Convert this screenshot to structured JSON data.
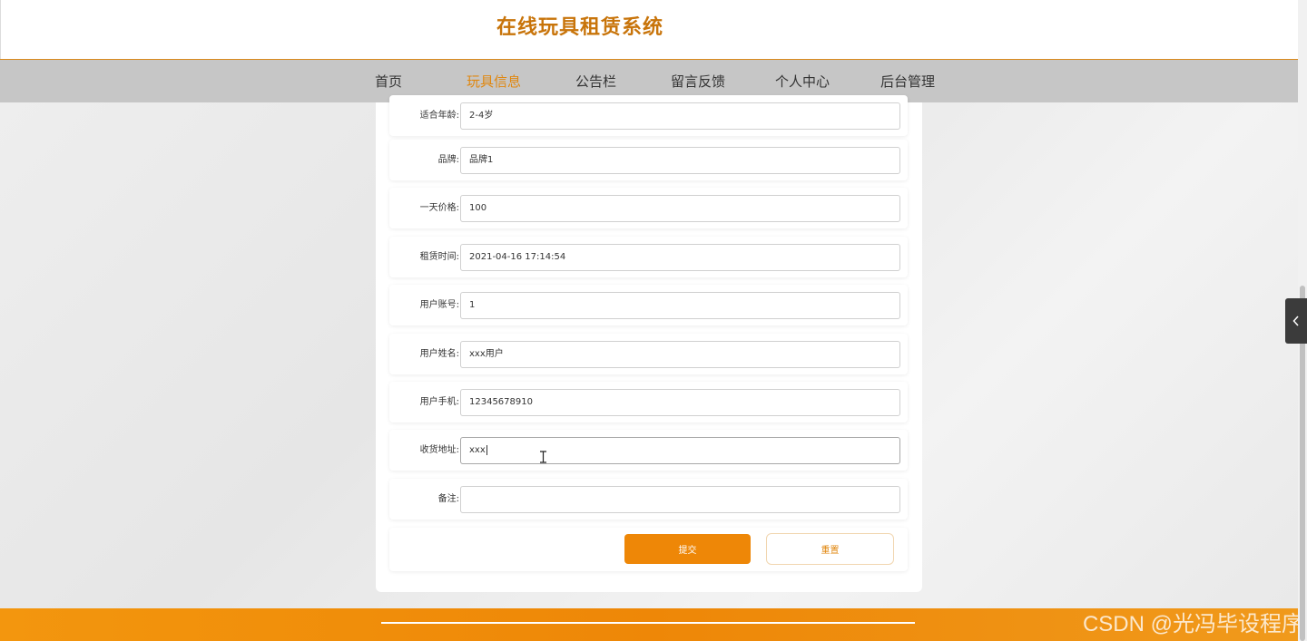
{
  "header": {
    "title": "在线玩具租赁系统"
  },
  "nav": {
    "items": [
      {
        "label": "首页"
      },
      {
        "label": "玩具信息"
      },
      {
        "label": "公告栏"
      },
      {
        "label": "留言反馈"
      },
      {
        "label": "个人中心"
      },
      {
        "label": "后台管理"
      }
    ],
    "active_index": 1
  },
  "form": {
    "fields": [
      {
        "label": "适合年龄:",
        "value": "2-4岁"
      },
      {
        "label": "品牌:",
        "value": "品牌1"
      },
      {
        "label": "一天价格:",
        "value": "100"
      },
      {
        "label": "租赁时间:",
        "value": "2021-04-16 17:14:54"
      },
      {
        "label": "用户账号:",
        "value": "1"
      },
      {
        "label": "用户姓名:",
        "value": "xxx用户"
      },
      {
        "label": "用户手机:",
        "value": "12345678910"
      },
      {
        "label": "收货地址:",
        "value": "xxx"
      },
      {
        "label": "备注:",
        "value": ""
      }
    ],
    "submit_label": "提交",
    "reset_label": "重置"
  },
  "watermark": "CSDN @光冯毕设程序",
  "colors": {
    "accent": "#ee8707",
    "nav_bg": "#c6c6c6",
    "title": "#c8740a"
  },
  "icons": {
    "side_toggle": "chevron-left-icon",
    "cursor": "text-cursor-icon"
  }
}
